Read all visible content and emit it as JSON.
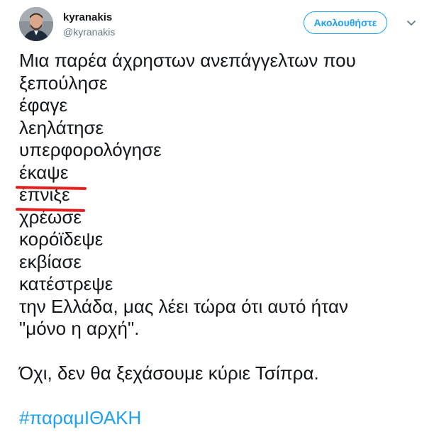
{
  "user": {
    "display_name": "kyranakis",
    "handle": "@kyranakis"
  },
  "actions": {
    "follow_label": "Ακολουθήστε"
  },
  "tweet": {
    "lines": [
      "Μια παρέα άχρηστων ανεπάγγελτων που",
      "ξεπούλησε",
      "έφαγε",
      "λεηλάτησε",
      "υπερφορολόγησε",
      "έκαψε",
      "έπνιξε",
      "χρέωσε",
      "κορόϊδεψε",
      "εκβίασε",
      "κατέστρεψε",
      "την Ελλάδα, μας λέει τώρα ότι αυτό ήταν",
      "\"μόνο η αρχή\"."
    ],
    "closing": "Όχι, δεν θα ξεχάσουμε κύριε Τσίπρα.",
    "hashtag": "#παραμΙΘΑΚΗ"
  },
  "colors": {
    "accent": "#1da1f2",
    "text": "#14171a",
    "secondary": "#657786",
    "underline": "#e0201f"
  },
  "icons": {
    "caret": "chevron-down-icon"
  }
}
